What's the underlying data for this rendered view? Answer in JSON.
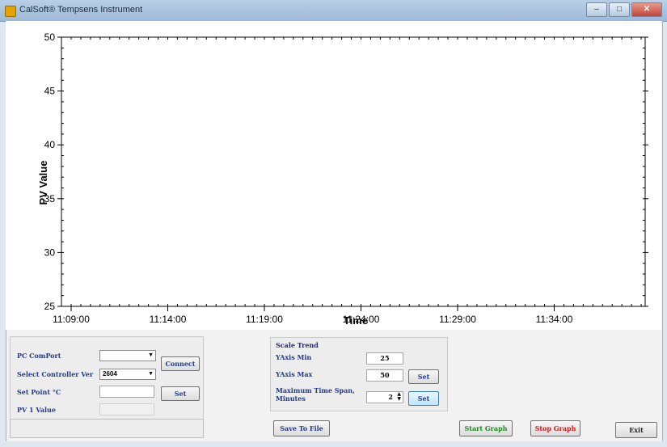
{
  "window": {
    "title": "CalSoft® Tempsens Instrument"
  },
  "chart_data": {
    "type": "line",
    "ylabel": "PV Value",
    "xlabel": "Time",
    "ylim": [
      25,
      50
    ],
    "yticks": [
      "25",
      "30",
      "35",
      "40",
      "45",
      "50"
    ],
    "xticks": [
      "11:09:00",
      "11:14:00",
      "11:19:00",
      "11:24:00",
      "11:29:00",
      "11:34:00"
    ],
    "series": [],
    "grid": false
  },
  "controls": {
    "com_port_label": "PC ComPort",
    "com_port_value": "",
    "connect_label": "Connect",
    "controller_label": "Select Controller Ver",
    "controller_value": "2604",
    "setpoint_label": "Set Point °C",
    "setpoint_value": "",
    "set_label": "Set",
    "pv_label": "PV 1 Value",
    "pv_value": ""
  },
  "scale": {
    "title": "Scale Trend",
    "ymin_label": "YAxis Min",
    "ymin_value": "25",
    "ymax_label": "YAxis Max",
    "ymax_value": "50",
    "ymax_set": "Set",
    "span_label_1": "Maximum Time Span,",
    "span_label_2": "Minutes",
    "span_value": "2",
    "span_set": "Set"
  },
  "buttons": {
    "save": "Save To File",
    "start": "Start Graph",
    "stop": "Stop Graph",
    "exit": "Exit"
  },
  "colors": {
    "start": "#1e8a1e",
    "stop": "#d21c1c"
  }
}
